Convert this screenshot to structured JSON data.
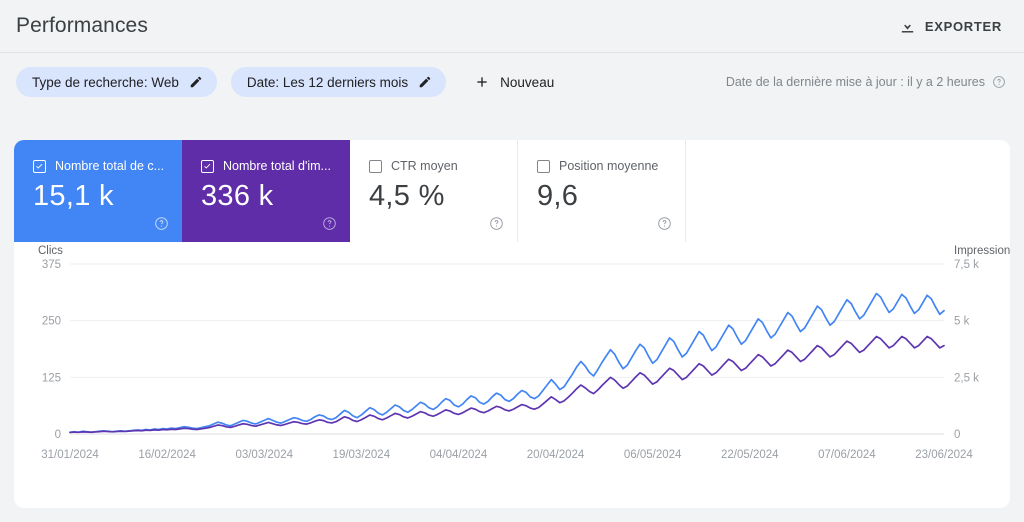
{
  "header": {
    "title": "Performances",
    "export_label": "EXPORTER",
    "export_icon": "download-icon"
  },
  "filters": {
    "chips": [
      {
        "label": "Type de recherche: Web",
        "edit_icon": "pencil-icon"
      },
      {
        "label": "Date: Les 12 derniers mois",
        "edit_icon": "pencil-icon"
      }
    ],
    "new_label": "Nouveau",
    "new_icon": "plus-icon",
    "updated_text": "Date de la dernière mise à jour : il y a 2 heures",
    "updated_help_icon": "help-icon"
  },
  "metrics": [
    {
      "title": "Nombre total de c...",
      "value": "15,1 k",
      "checked": true,
      "color": "#4285f4",
      "help_icon": "help-icon"
    },
    {
      "title": "Nombre total d'im...",
      "value": "336 k",
      "checked": true,
      "color": "#5f2da8",
      "help_icon": "help-icon"
    },
    {
      "title": "CTR moyen",
      "value": "4,5 %",
      "checked": false,
      "color": "#ffffff",
      "help_icon": "help-icon"
    },
    {
      "title": "Position moyenne",
      "value": "9,6",
      "checked": false,
      "color": "#ffffff",
      "help_icon": "help-icon"
    }
  ],
  "chart_data": {
    "type": "line",
    "title": "",
    "xlabel": "",
    "ylabel": "Clics",
    "y2label": "Impressions",
    "grid": true,
    "legend": "none",
    "x_tick_labels": [
      "31/01/2024",
      "16/02/2024",
      "03/03/2024",
      "19/03/2024",
      "04/04/2024",
      "20/04/2024",
      "06/05/2024",
      "22/05/2024",
      "07/06/2024",
      "23/06/2024"
    ],
    "ylim": [
      0,
      375
    ],
    "y_ticks": [
      0,
      125,
      250,
      375
    ],
    "y_tick_labels": [
      "0",
      "125",
      "250",
      "375"
    ],
    "y2lim": [
      0,
      7500
    ],
    "y2_ticks": [
      0,
      2500,
      5000,
      7500
    ],
    "y2_tick_labels": [
      "0",
      "2,5 k",
      "5 k",
      "7,5 k"
    ],
    "series": [
      {
        "name": "Clics",
        "color": "#4285f4",
        "axis": "left",
        "values": [
          4,
          5,
          4,
          6,
          5,
          4,
          5,
          6,
          7,
          6,
          5,
          6,
          7,
          6,
          7,
          8,
          9,
          8,
          10,
          9,
          11,
          10,
          12,
          11,
          13,
          12,
          14,
          16,
          15,
          13,
          12,
          14,
          16,
          18,
          22,
          26,
          24,
          20,
          18,
          22,
          26,
          30,
          28,
          24,
          22,
          26,
          30,
          34,
          30,
          26,
          24,
          28,
          32,
          36,
          34,
          30,
          28,
          32,
          38,
          42,
          40,
          34,
          32,
          36,
          44,
          52,
          48,
          40,
          36,
          42,
          50,
          58,
          54,
          46,
          42,
          48,
          56,
          64,
          60,
          52,
          48,
          54,
          62,
          70,
          66,
          58,
          54,
          60,
          70,
          78,
          74,
          64,
          60,
          66,
          76,
          84,
          80,
          70,
          66,
          72,
          82,
          90,
          86,
          76,
          72,
          78,
          88,
          96,
          92,
          82,
          78,
          84,
          96,
          108,
          120,
          110,
          98,
          104,
          118,
          132,
          148,
          160,
          150,
          136,
          128,
          142,
          158,
          172,
          186,
          176,
          158,
          144,
          152,
          168,
          184,
          198,
          190,
          172,
          156,
          164,
          180,
          196,
          212,
          204,
          186,
          170,
          178,
          194,
          210,
          226,
          218,
          200,
          184,
          192,
          208,
          224,
          240,
          232,
          214,
          198,
          206,
          222,
          238,
          254,
          246,
          228,
          212,
          220,
          236,
          252,
          268,
          260,
          242,
          226,
          234,
          250,
          266,
          282,
          274,
          256,
          240,
          248,
          264,
          280,
          296,
          288,
          270,
          254,
          262,
          278,
          294,
          310,
          302,
          284,
          268,
          276,
          292,
          308,
          300,
          282,
          266,
          274,
          290,
          306,
          298,
          280,
          264,
          272
        ]
      },
      {
        "name": "Impressions",
        "color": "#5e35b1",
        "axis": "right",
        "values": [
          70,
          85,
          75,
          95,
          88,
          78,
          90,
          105,
          118,
          110,
          96,
          108,
          122,
          112,
          124,
          140,
          155,
          142,
          168,
          156,
          182,
          170,
          196,
          184,
          210,
          198,
          226,
          252,
          240,
          212,
          198,
          224,
          252,
          286,
          340,
          396,
          372,
          316,
          288,
          340,
          398,
          452,
          428,
          372,
          344,
          398,
          454,
          508,
          456,
          402,
          376,
          428,
          486,
          540,
          516,
          462,
          436,
          490,
          566,
          622,
          596,
          516,
          488,
          542,
          652,
          760,
          706,
          600,
          552,
          628,
          730,
          836,
          786,
          682,
          628,
          706,
          808,
          910,
          860,
          756,
          706,
          782,
          884,
          986,
          936,
          834,
          784,
          858,
          962,
          1064,
          1014,
          912,
          862,
          936,
          1040,
          1142,
          1092,
          990,
          940,
          1014,
          1118,
          1220,
          1170,
          1068,
          1018,
          1092,
          1196,
          1298,
          1248,
          1146,
          1096,
          1170,
          1320,
          1480,
          1640,
          1520,
          1380,
          1460,
          1620,
          1800,
          2000,
          2160,
          2040,
          1880,
          1780,
          1940,
          2140,
          2320,
          2500,
          2380,
          2180,
          2020,
          2120,
          2320,
          2520,
          2700,
          2600,
          2400,
          2200,
          2300,
          2500,
          2700,
          2900,
          2800,
          2600,
          2400,
          2500,
          2700,
          2900,
          3100,
          3000,
          2800,
          2600,
          2700,
          2900,
          3100,
          3300,
          3200,
          3000,
          2800,
          2900,
          3100,
          3300,
          3500,
          3400,
          3200,
          3000,
          3100,
          3300,
          3500,
          3700,
          3600,
          3400,
          3200,
          3300,
          3500,
          3700,
          3900,
          3800,
          3600,
          3400,
          3500,
          3700,
          3900,
          4100,
          4000,
          3800,
          3600,
          3700,
          3900,
          4100,
          4300,
          4200,
          4000,
          3800,
          3900,
          4100,
          4300,
          4200,
          4000,
          3800,
          3900,
          4100,
          4300,
          4200,
          4000,
          3800,
          3900
        ]
      }
    ]
  }
}
